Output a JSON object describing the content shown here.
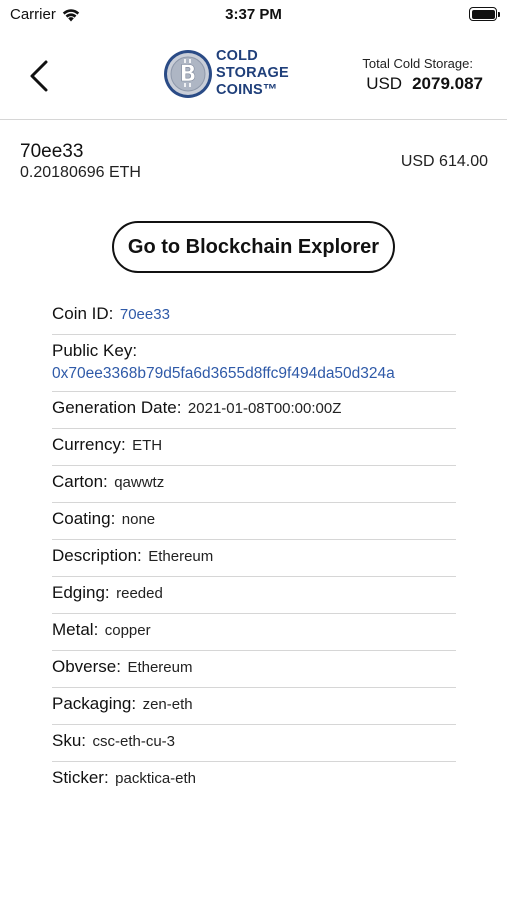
{
  "status_bar": {
    "carrier": "Carrier",
    "time": "3:37 PM"
  },
  "header": {
    "logo_lines": [
      "COLD",
      "STORAGE",
      "COINS™"
    ],
    "total_label": "Total Cold Storage:",
    "currency": "USD",
    "total_value": "2079.087"
  },
  "coin": {
    "id": "70ee33",
    "amount": "0.20180696 ETH",
    "usd_value": "USD 614.00"
  },
  "explorer_button": {
    "label": "Go to Blockchain Explorer"
  },
  "details": [
    {
      "label": "Coin ID:",
      "value": "70ee33"
    },
    {
      "label": "Public Key:",
      "value": "0x70ee3368b79d5fa6d3655d8ffc9f494da50d324a"
    },
    {
      "label": "Generation Date:",
      "value": "2021-01-08T00:00:00Z"
    },
    {
      "label": "Currency:",
      "value": "ETH"
    },
    {
      "label": "Carton:",
      "value": "qawwtz"
    },
    {
      "label": "Coating:",
      "value": "none"
    },
    {
      "label": "Description:",
      "value": "Ethereum"
    },
    {
      "label": "Edging:",
      "value": "reeded"
    },
    {
      "label": "Metal:",
      "value": "copper"
    },
    {
      "label": "Obverse:",
      "value": "Ethereum"
    },
    {
      "label": "Packaging:",
      "value": "zen-eth"
    },
    {
      "label": "Sku:",
      "value": "csc-eth-cu-3"
    },
    {
      "label": "Sticker:",
      "value": "packtica-eth"
    }
  ],
  "colors": {
    "link": "#2f5aa8",
    "brand": "#1f3f7a",
    "divider": "#d6d6d6"
  },
  "icons": [
    "wifi-icon",
    "battery-icon",
    "back-chevron-icon",
    "bitcoin-coin-logo"
  ]
}
